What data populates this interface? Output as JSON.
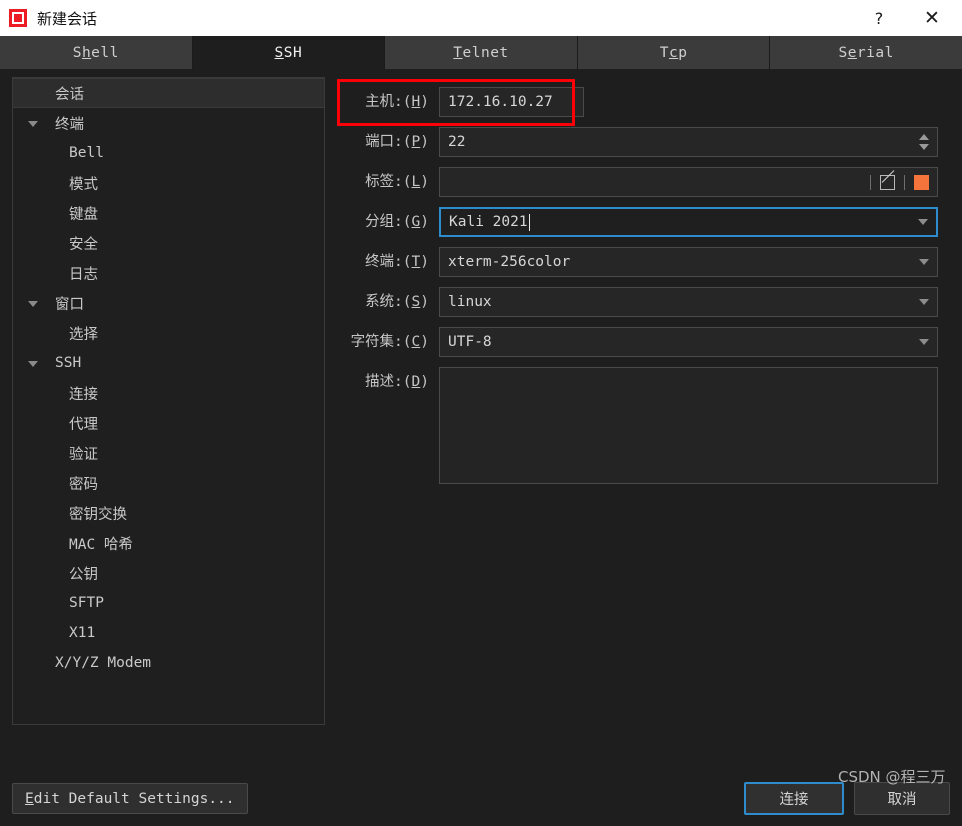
{
  "window": {
    "title": "新建会话",
    "icon": "app-logo-icon",
    "help_label": "?",
    "close_label": "✕"
  },
  "tabs": [
    {
      "label": "Shell",
      "mnemonic_index": 1,
      "active": false
    },
    {
      "label": "SSH",
      "mnemonic_index": 0,
      "active": true
    },
    {
      "label": "Telnet",
      "mnemonic_index": 0,
      "active": false
    },
    {
      "label": "Tcp",
      "mnemonic_index": 1,
      "active": false
    },
    {
      "label": "Serial",
      "mnemonic_index": 1,
      "active": false
    }
  ],
  "sidebar": {
    "items": [
      {
        "label": "会话",
        "level": 1,
        "arrow": false,
        "selected": true
      },
      {
        "label": "终端",
        "level": 1,
        "arrow": true,
        "selected": false
      },
      {
        "label": "Bell",
        "level": 2,
        "arrow": false,
        "selected": false
      },
      {
        "label": "模式",
        "level": 2,
        "arrow": false,
        "selected": false
      },
      {
        "label": "键盘",
        "level": 2,
        "arrow": false,
        "selected": false
      },
      {
        "label": "安全",
        "level": 2,
        "arrow": false,
        "selected": false
      },
      {
        "label": "日志",
        "level": 2,
        "arrow": false,
        "selected": false
      },
      {
        "label": "窗口",
        "level": 1,
        "arrow": true,
        "selected": false
      },
      {
        "label": "选择",
        "level": 2,
        "arrow": false,
        "selected": false
      },
      {
        "label": "SSH",
        "level": 1,
        "arrow": true,
        "selected": false
      },
      {
        "label": "连接",
        "level": 2,
        "arrow": false,
        "selected": false
      },
      {
        "label": "代理",
        "level": 2,
        "arrow": false,
        "selected": false
      },
      {
        "label": "验证",
        "level": 2,
        "arrow": false,
        "selected": false
      },
      {
        "label": "密码",
        "level": 2,
        "arrow": false,
        "selected": false
      },
      {
        "label": "密钥交换",
        "level": 2,
        "arrow": false,
        "selected": false
      },
      {
        "label": "MAC 哈希",
        "level": 2,
        "arrow": false,
        "selected": false
      },
      {
        "label": "公钥",
        "level": 2,
        "arrow": false,
        "selected": false
      },
      {
        "label": "SFTP",
        "level": 2,
        "arrow": false,
        "selected": false
      },
      {
        "label": "X11",
        "level": 2,
        "arrow": false,
        "selected": false
      },
      {
        "label": "X/Y/Z Modem",
        "level": 1,
        "arrow": false,
        "selected": false
      }
    ]
  },
  "form": {
    "host": {
      "label_pre": "主机:(",
      "mnemonic": "H",
      "label_post": ")",
      "value": "172.16.10.27",
      "highlighted": true
    },
    "port": {
      "label_pre": "端口:(",
      "mnemonic": "P",
      "label_post": ")",
      "value": "22"
    },
    "tag": {
      "label_pre": "标签:(",
      "mnemonic": "L",
      "label_post": ")",
      "value": "",
      "color": "#f4743b"
    },
    "group": {
      "label_pre": "分组:(",
      "mnemonic": "G",
      "label_post": ")",
      "value": "Kali 2021",
      "focused": true
    },
    "terminal": {
      "label_pre": "终端:(",
      "mnemonic": "T",
      "label_post": ")",
      "value": "xterm-256color"
    },
    "system": {
      "label_pre": "系统:(",
      "mnemonic": "S",
      "label_post": ")",
      "value": "linux"
    },
    "charset": {
      "label_pre": "字符集:(",
      "mnemonic": "C",
      "label_post": ")",
      "value": "UTF-8"
    },
    "description": {
      "label_pre": "描述:(",
      "mnemonic": "D",
      "label_post": ")",
      "value": ""
    }
  },
  "footer": {
    "edit_defaults": {
      "pre": "",
      "mnemonic": "E",
      "post": "dit Default Settings..."
    },
    "connect": "连接",
    "cancel": "取消"
  },
  "watermark": "CSDN @程三万",
  "colors": {
    "accent_blue": "#2f8ccc",
    "annotation_red": "#fb0007",
    "tag_swatch": "#f4743b",
    "window_bg": "#1e1e1e"
  }
}
